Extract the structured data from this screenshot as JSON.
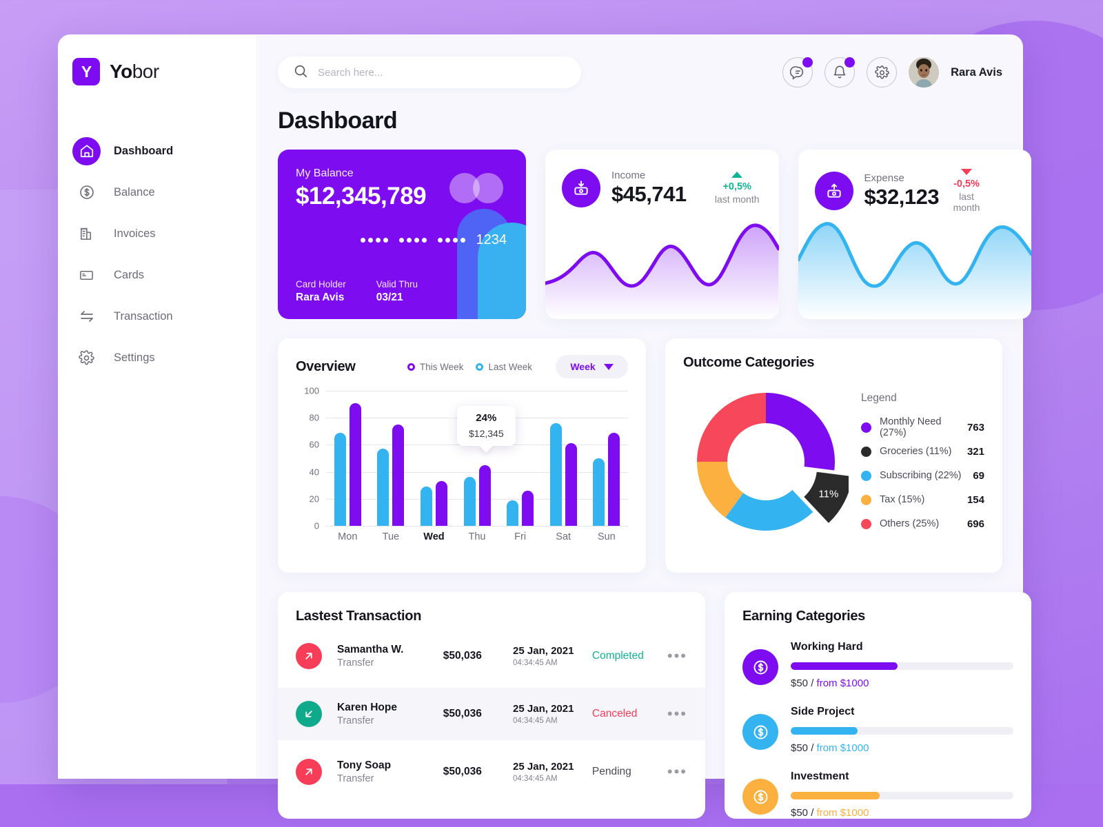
{
  "brand": {
    "mark": "Y",
    "name_bold": "Yo",
    "name_light": "bor"
  },
  "sidebar": {
    "items": [
      {
        "label": "Dashboard",
        "icon": "home-icon"
      },
      {
        "label": "Balance",
        "icon": "dollar-circle-icon"
      },
      {
        "label": "Invoices",
        "icon": "invoice-icon"
      },
      {
        "label": "Cards",
        "icon": "card-icon"
      },
      {
        "label": "Transaction",
        "icon": "transfer-arrows-icon"
      },
      {
        "label": "Settings",
        "icon": "gear-icon"
      }
    ]
  },
  "topbar": {
    "search_placeholder": "Search here...",
    "search_value": "",
    "icons": [
      "message-icon",
      "bell-icon",
      "gear-icon"
    ],
    "user_name": "Rara Avis"
  },
  "page_title": "Dashboard",
  "balance_card": {
    "label": "My Balance",
    "amount": "$12,345,789",
    "card_number_last4": "1234",
    "holder_label": "Card Holder",
    "holder_value": "Rara Avis",
    "valid_label": "Valid Thru",
    "valid_value": "03/21"
  },
  "stats": [
    {
      "label": "Income",
      "value": "$45,741",
      "icon": "download-money-icon",
      "delta": "+0,5%",
      "delta_dir": "up",
      "delta_note": "last month",
      "delta_color": "#11b394",
      "accent": "#7d0df0"
    },
    {
      "label": "Expense",
      "value": "$32,123",
      "icon": "upload-money-icon",
      "delta": "-0,5%",
      "delta_dir": "down",
      "delta_note": "last month",
      "delta_color": "#f73d57",
      "accent": "#34b3f1"
    }
  ],
  "overview": {
    "title": "Overview",
    "toggle_this_week": "This Week",
    "toggle_last_week": "Last Week",
    "dropdown_value": "Week",
    "tooltip_percent": "24%",
    "tooltip_amount": "$12,345"
  },
  "outcome": {
    "title": "Outcome Categories",
    "legend_title": "Legend",
    "callout": "11%"
  },
  "transactions": {
    "title": "Lastest Transaction",
    "rows": [
      {
        "name": "Samantha W.",
        "type": "Transfer",
        "amount": "$50,036",
        "date": "25 Jan, 2021",
        "time": "04:34:45 AM",
        "status": "Completed",
        "status_color": "#0fb392",
        "dir": "out",
        "icon_color": "#f73d57",
        "more": "•••"
      },
      {
        "name": "Karen Hope",
        "type": "Transfer",
        "amount": "$50,036",
        "date": "25 Jan, 2021",
        "time": "04:34:45 AM",
        "status": "Canceled",
        "status_color": "#f73d57",
        "dir": "in",
        "icon_color": "#0fa98b",
        "more": "•••"
      },
      {
        "name": "Tony Soap",
        "type": "Transfer",
        "amount": "$50,036",
        "date": "25 Jan, 2021",
        "time": "04:34:45 AM",
        "status": "Pending",
        "status_color": "#4a4a56",
        "dir": "out",
        "icon_color": "#f73d57",
        "more": "•••"
      }
    ]
  },
  "earning": {
    "title": "Earning Categories",
    "items": [
      {
        "name": "Working Hard",
        "current": "$50",
        "sep": "/",
        "goal": "from $1000",
        "color": "#7d0df0",
        "percent": 48
      },
      {
        "name": "Side Project",
        "current": "$50",
        "sep": "/",
        "goal": "from $1000",
        "color": "#34b3f1",
        "percent": 30
      },
      {
        "name": "Investment",
        "current": "$50",
        "sep": "/",
        "goal": "from $1000",
        "color": "#fbb040",
        "percent": 40
      }
    ]
  },
  "chart_data": [
    {
      "type": "bar",
      "title": "Overview",
      "categories": [
        "Mon",
        "Tue",
        "Wed",
        "Thu",
        "Fri",
        "Sat",
        "Sun"
      ],
      "series": [
        {
          "name": "Last Week",
          "color": "#34b3f1",
          "values": [
            69,
            57,
            29,
            36,
            19,
            76,
            50
          ]
        },
        {
          "name": "This Week",
          "color": "#7d0df0",
          "values": [
            91,
            75,
            33,
            45,
            26,
            61,
            69
          ]
        }
      ],
      "yticks": [
        100,
        80,
        60,
        40,
        20,
        0
      ],
      "ylim": [
        0,
        100
      ],
      "xlabel": "",
      "ylabel": "",
      "grid": true,
      "legend": "top-right",
      "highlight_category": "Wed",
      "annotation": {
        "percent": "24%",
        "amount": "$12,345"
      }
    },
    {
      "type": "pie",
      "title": "Outcome Categories",
      "donut": true,
      "labels": [
        "Monthly Need",
        "Groceries",
        "Subscribing",
        "Tax",
        "Others"
      ],
      "percents": [
        27,
        11,
        22,
        15,
        25
      ],
      "values": [
        763,
        321,
        69,
        154,
        696
      ],
      "colors": [
        "#7d0df0",
        "#2b2b2b",
        "#34b3f1",
        "#fbb040",
        "#f7485b"
      ],
      "exploded_slice": "Groceries",
      "legend": "right"
    },
    {
      "type": "area",
      "title": "Income",
      "color": "#7d0df0",
      "values": [
        30,
        42,
        55,
        48,
        28,
        22,
        38,
        56,
        60,
        44,
        26,
        30,
        58,
        80,
        86,
        70
      ],
      "ylim": [
        0,
        100
      ]
    },
    {
      "type": "area",
      "title": "Expense",
      "color": "#34b3f1",
      "values": [
        36,
        55,
        72,
        82,
        66,
        40,
        28,
        34,
        52,
        62,
        54,
        34,
        30,
        52,
        76,
        84,
        70
      ],
      "ylim": [
        0,
        100
      ]
    }
  ]
}
